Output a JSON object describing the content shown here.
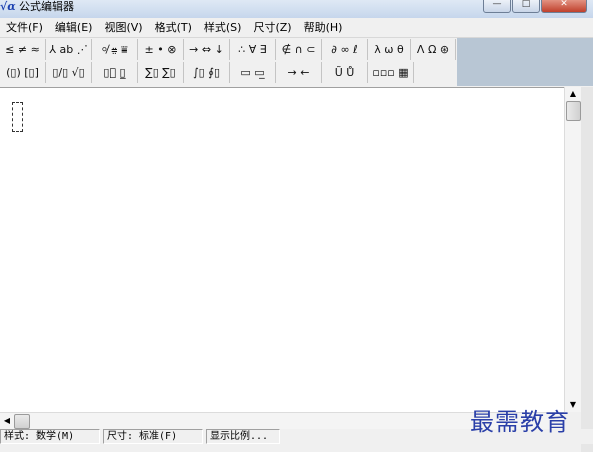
{
  "window": {
    "title": "公式编辑器",
    "app_icon": "√α",
    "minimize": "—",
    "maximize": "□",
    "close": "✕"
  },
  "menu": [
    "文件(F)",
    "编辑(E)",
    "视图(V)",
    "格式(T)",
    "样式(S)",
    "尺寸(Z)",
    "帮助(H)"
  ],
  "toolbar_row1": [
    "≤ ≠ ≈",
    "⅄ ab ⋰",
    "⸰̸ ⩷ ⩸",
    "± • ⊗",
    "→ ⇔ ↓",
    "∴ ∀ ∃",
    "∉ ∩ ⊂",
    "∂ ∞ ℓ",
    "λ ω θ",
    "Λ Ω ⊛"
  ],
  "toolbar_row2": [
    "(▯) [▯]",
    "▯/▯ √▯",
    "▯⃞ ▯̲",
    "∑▯ ∑▯",
    "∫▯ ∮▯",
    "▭ ▭̲",
    "→ ←",
    "Ũ Ů",
    "▫▫▫ ▦"
  ],
  "status": {
    "style": "样式: 数学(M)",
    "size": "尺寸: 标准(F)",
    "zoom": "显示比例..."
  },
  "watermark": "最需教育",
  "scroll": {
    "up": "▲",
    "down": "▼",
    "left": "◀"
  }
}
